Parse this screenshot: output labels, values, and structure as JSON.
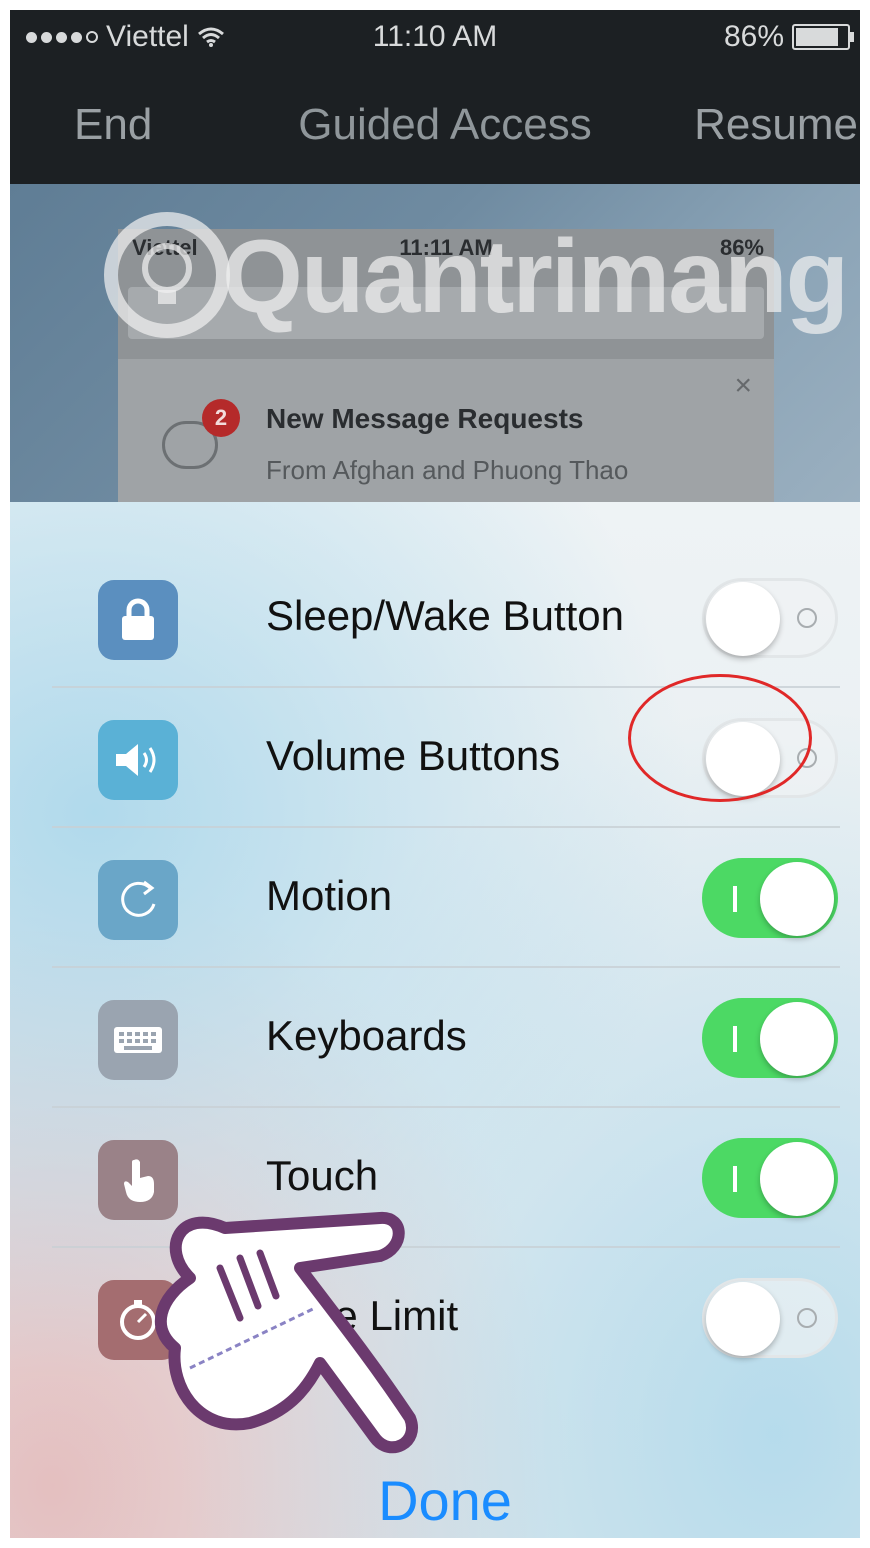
{
  "status_bar": {
    "carrier": "Viettel",
    "time": "11:10 AM",
    "battery": "86%",
    "battery_level": 0.86
  },
  "nav": {
    "end_label": "End",
    "title": "Guided Access",
    "resume_label": "Resume"
  },
  "preview": {
    "status": {
      "carrier": "Viettel",
      "time": "11:11 AM",
      "battery": "86%"
    },
    "card": {
      "badge_count": "2",
      "title": "New Message Requests",
      "subtitle": "From Afghan and Phuong Thao",
      "close_glyph": "×"
    }
  },
  "watermark": {
    "text": "Quantrimang"
  },
  "options": [
    {
      "label": "Sleep/Wake Button",
      "icon": "lock-icon",
      "icon_color": "#5b8fbf",
      "enabled": false
    },
    {
      "label": "Volume Buttons",
      "icon": "speaker-icon",
      "icon_color": "#5ab1d6",
      "enabled": false
    },
    {
      "label": "Motion",
      "icon": "rotate-icon",
      "icon_color": "#6aa6c8",
      "enabled": true
    },
    {
      "label": "Keyboards",
      "icon": "keyboard-icon",
      "icon_color": "#9aa4b0",
      "enabled": true
    },
    {
      "label": "Touch",
      "icon": "hand-icon",
      "icon_color": "#9a8288",
      "enabled": true
    },
    {
      "label": "Time Limit",
      "icon": "timer-icon",
      "icon_color": "#a46d70",
      "enabled": false
    }
  ],
  "done_label": "Done",
  "colors": {
    "toggle_on": "#4cd964",
    "done": "#1a8cff",
    "annotation": "#e02828"
  }
}
